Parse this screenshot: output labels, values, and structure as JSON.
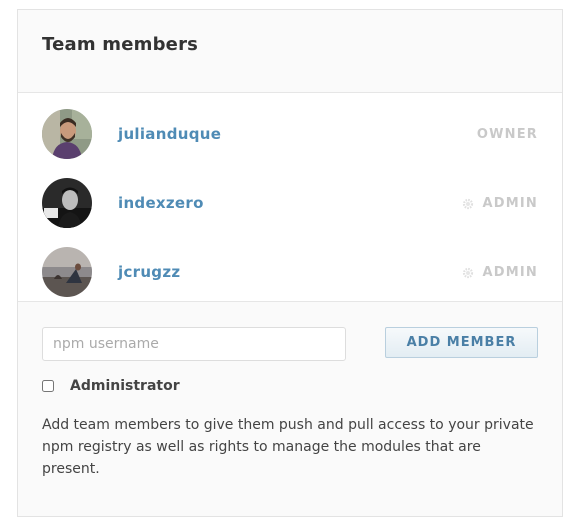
{
  "panel": {
    "title": "Team members"
  },
  "members": [
    {
      "username": "julianduque",
      "role": "OWNER",
      "show_gear": false
    },
    {
      "username": "indexzero",
      "role": "ADMIN",
      "show_gear": true
    },
    {
      "username": "jcrugzz",
      "role": "ADMIN",
      "show_gear": true
    }
  ],
  "form": {
    "username_placeholder": "npm username",
    "username_value": "",
    "add_button_label": "ADD MEMBER",
    "admin_checkbox_label": "Administrator",
    "admin_checked": false,
    "help_text": "Add team members to give them push and pull access to your private npm registry as well as rights to manage the modules that are present."
  },
  "colors": {
    "link": "#4f8bb5",
    "role": "#c9c9c9",
    "button_text": "#4a7fa6"
  },
  "icons": {
    "role_action": "gear-icon"
  }
}
